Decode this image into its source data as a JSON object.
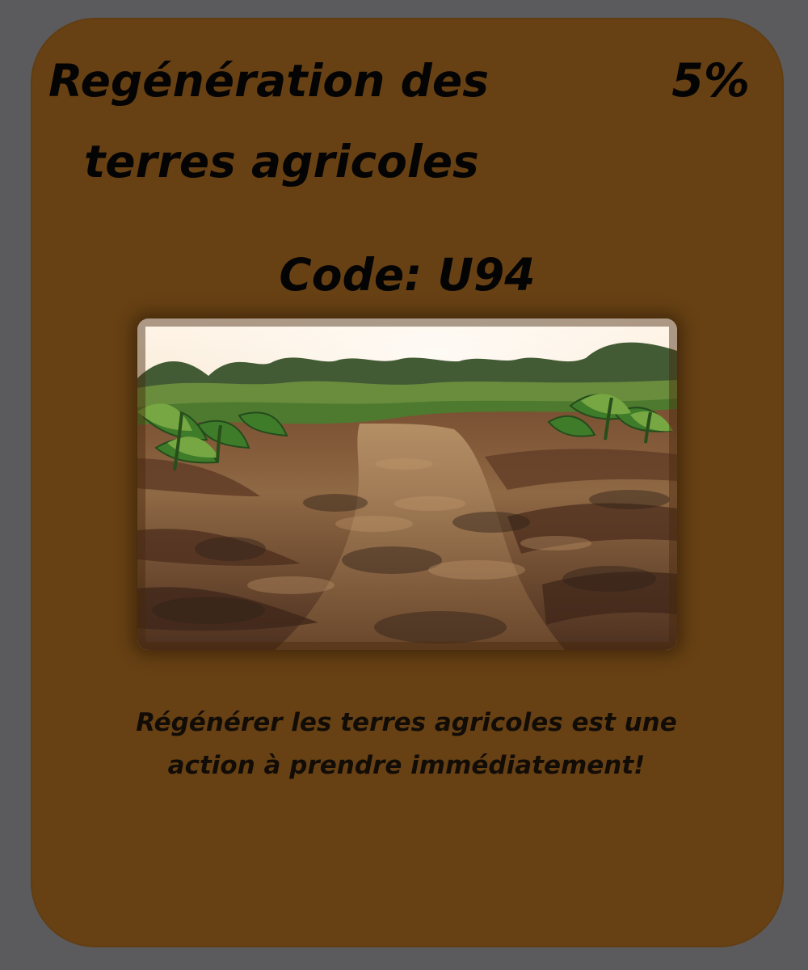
{
  "card": {
    "title_line_1": "Regénération des",
    "title_line_2": "terres agricoles",
    "percentage": "5%",
    "code": "Code: U94",
    "description": "Régénérer les terres agricoles est une action à prendre immédiatement!",
    "colors": {
      "background": "#5b5b5d",
      "card": "#674114",
      "text": "#050404"
    },
    "image": {
      "icon": "agricultural-field-photo"
    }
  }
}
